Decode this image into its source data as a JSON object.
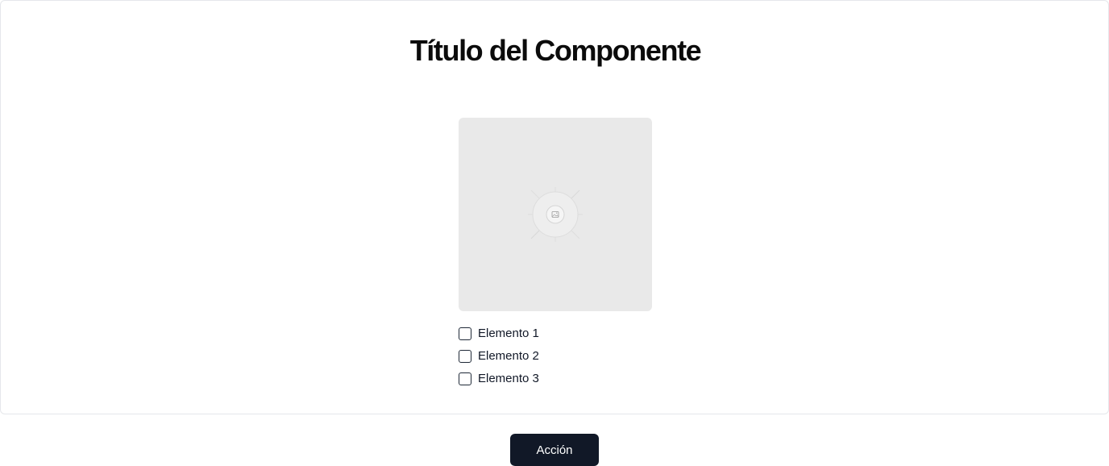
{
  "card": {
    "title": "Título del Componente",
    "image": {
      "icon": "image-placeholder-icon"
    },
    "checklist": [
      {
        "label": "Elemento 1",
        "checked": false
      },
      {
        "label": "Elemento 2",
        "checked": false
      },
      {
        "label": "Elemento 3",
        "checked": false
      }
    ]
  },
  "action": {
    "label": "Acción"
  },
  "colors": {
    "button_bg": "#111827",
    "placeholder_bg": "#e9e9e9",
    "border": "#e5e7eb"
  }
}
